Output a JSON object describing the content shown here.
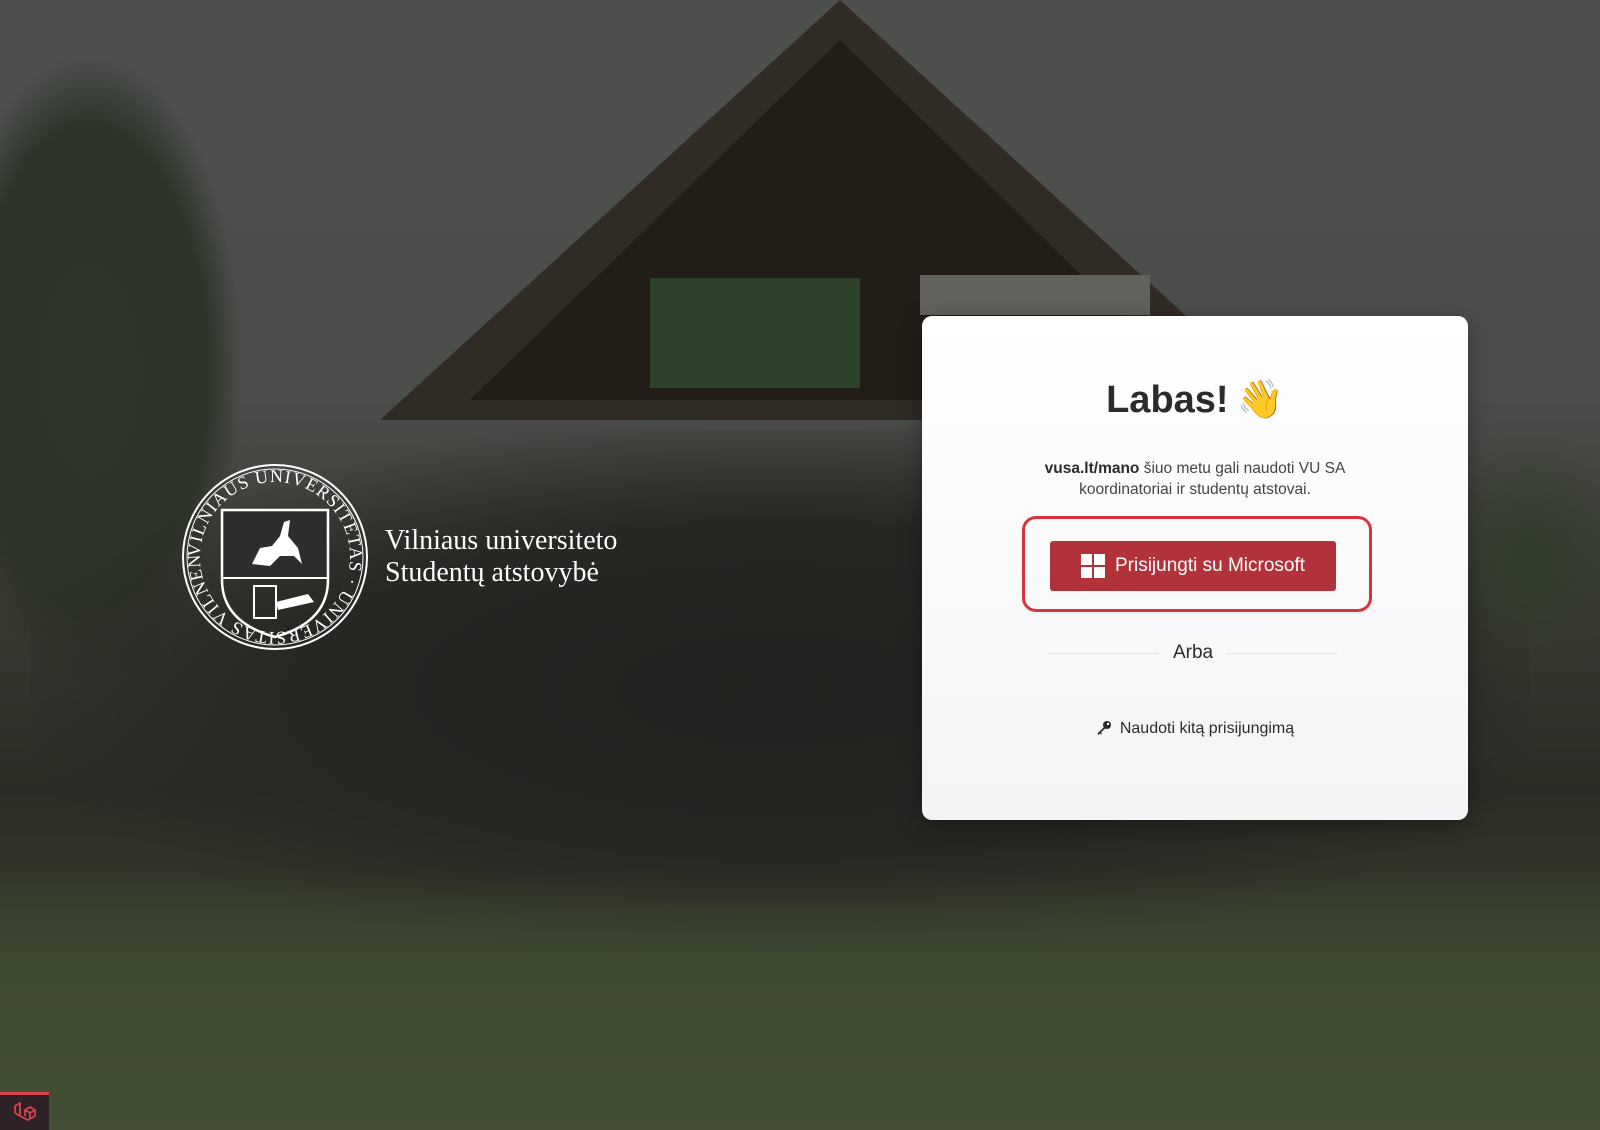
{
  "logo": {
    "seal_text": "VILNIAUS UNIVERSITETAS · UNIVERSITAS VILNENSIS · 1579",
    "line1": "Vilniaus universiteto",
    "line2": "Studentų atstovybė"
  },
  "card": {
    "title": "Labas!",
    "title_emoji": "👋",
    "desc_bold": "vusa.lt/mano",
    "desc_rest": " šiuo metu gali naudoti VU SA koordinatoriai ir studentų atstovai.",
    "microsoft_button_label": "Prisijungti su Microsoft",
    "microsoft_icon": "windows-icon",
    "divider_label": "Arba",
    "alt_link_icon": "key-icon",
    "alt_link_label": "Naudoti kitą prisijungimą"
  },
  "badge": {
    "icon": "laravel-icon"
  },
  "colors": {
    "accent": "#b2323b",
    "highlight_outline": "#d9343c",
    "text": "#2b2b2e"
  }
}
